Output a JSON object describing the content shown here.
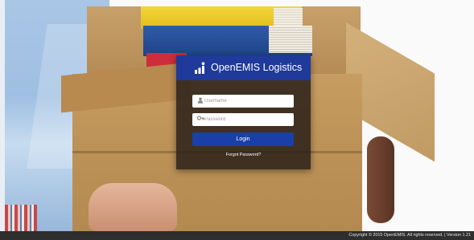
{
  "login_panel": {
    "app_title": "OpenEMIS Logistics",
    "logo_icon": "bar-chart-person-icon",
    "username": {
      "placeholder": "Username",
      "value": "",
      "icon": "user-icon"
    },
    "password": {
      "placeholder": "Password",
      "value": "",
      "icon": "key-icon"
    },
    "login_label": "Login",
    "forgot_label": "Forgot Password?",
    "header_color": "#1f3a9a",
    "button_color": "#1a3fa8"
  },
  "footer": {
    "text": "Copyright © 2015 OpenEMIS. All rights reserved. | Version 1.21"
  }
}
